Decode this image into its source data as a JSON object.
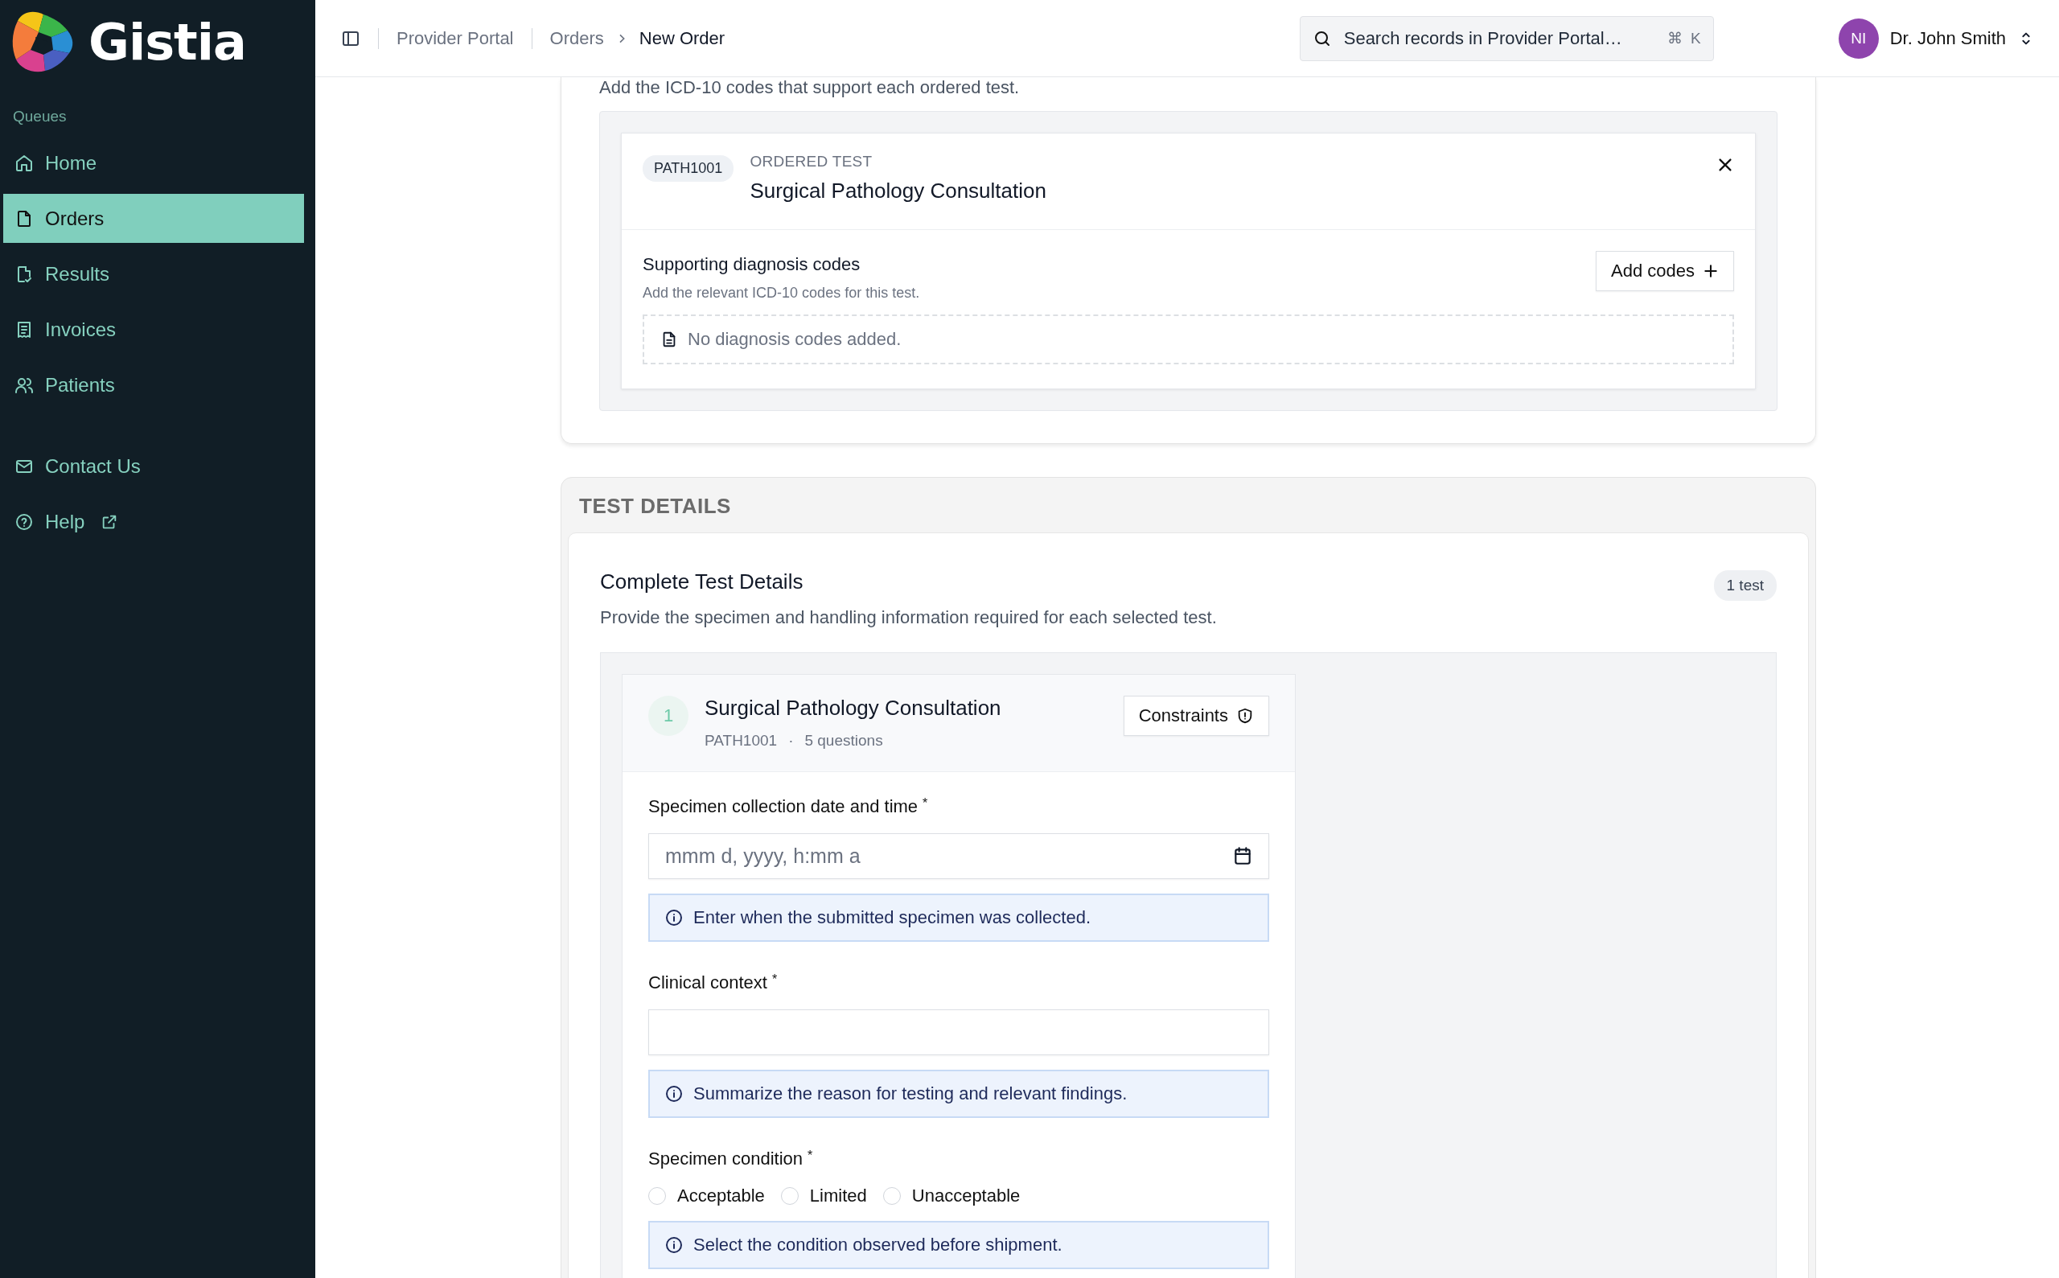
{
  "app": {
    "logo": "Gistia"
  },
  "sidebar": {
    "section": "Queues",
    "items": [
      {
        "label": "Home",
        "selected": false
      },
      {
        "label": "Orders",
        "selected": true
      },
      {
        "label": "Results",
        "selected": false
      },
      {
        "label": "Invoices",
        "selected": false
      },
      {
        "label": "Patients",
        "selected": false
      }
    ],
    "secondary": [
      {
        "label": "Contact Us",
        "external": false
      },
      {
        "label": "Help",
        "external": true
      }
    ]
  },
  "header": {
    "breadcrumbs": [
      {
        "label": "Provider Portal",
        "current": false
      },
      {
        "label": "Orders",
        "current": false
      },
      {
        "label": "New Order",
        "current": true
      }
    ],
    "search": {
      "placeholder": "Search records in Provider Portal…",
      "shortcut": [
        "⌘",
        "K"
      ]
    },
    "user": {
      "initials": "NI",
      "name": "Dr. John Smith"
    }
  },
  "order_card": {
    "intro": "Add the ICD-10 codes that support each ordered test.",
    "tests": [
      {
        "code": "PATH1001",
        "eyebrow": "ORDERED TEST",
        "name": "Surgical Pathology Consultation",
        "codes_title": "Supporting diagnosis codes",
        "codes_hint": "Add the relevant ICD-10 codes for this test.",
        "add_button": "Add codes",
        "empty": "No diagnosis codes added."
      }
    ]
  },
  "test_details": {
    "heading": "TEST DETAILS",
    "title": "Complete Test Details",
    "count": "1 test",
    "description": "Provide the specimen and handling information required for each selected test.",
    "tests": [
      {
        "number": "1",
        "name": "Surgical Pathology Consultation",
        "code": "PATH1001",
        "separator": "·",
        "questions": "5 questions",
        "constraints_button": "Constraints",
        "fields": [
          {
            "kind": "date",
            "label": "Specimen collection date and time",
            "required_mark": "*",
            "placeholder": "mmm d, yyyy, h:mm a",
            "hint": "Enter when the submitted specimen was collected."
          },
          {
            "kind": "text",
            "label": "Clinical context",
            "required_mark": "*",
            "hint": "Summarize the reason for testing and relevant findings."
          },
          {
            "kind": "radio",
            "label": "Specimen condition",
            "required_mark": "*",
            "options": [
              {
                "label": "Acceptable",
                "selected": false
              },
              {
                "label": "Limited",
                "selected": false
              },
              {
                "label": "Unacceptable",
                "selected": false
              }
            ],
            "hint": "Select the condition observed before shipment."
          }
        ]
      }
    ]
  }
}
